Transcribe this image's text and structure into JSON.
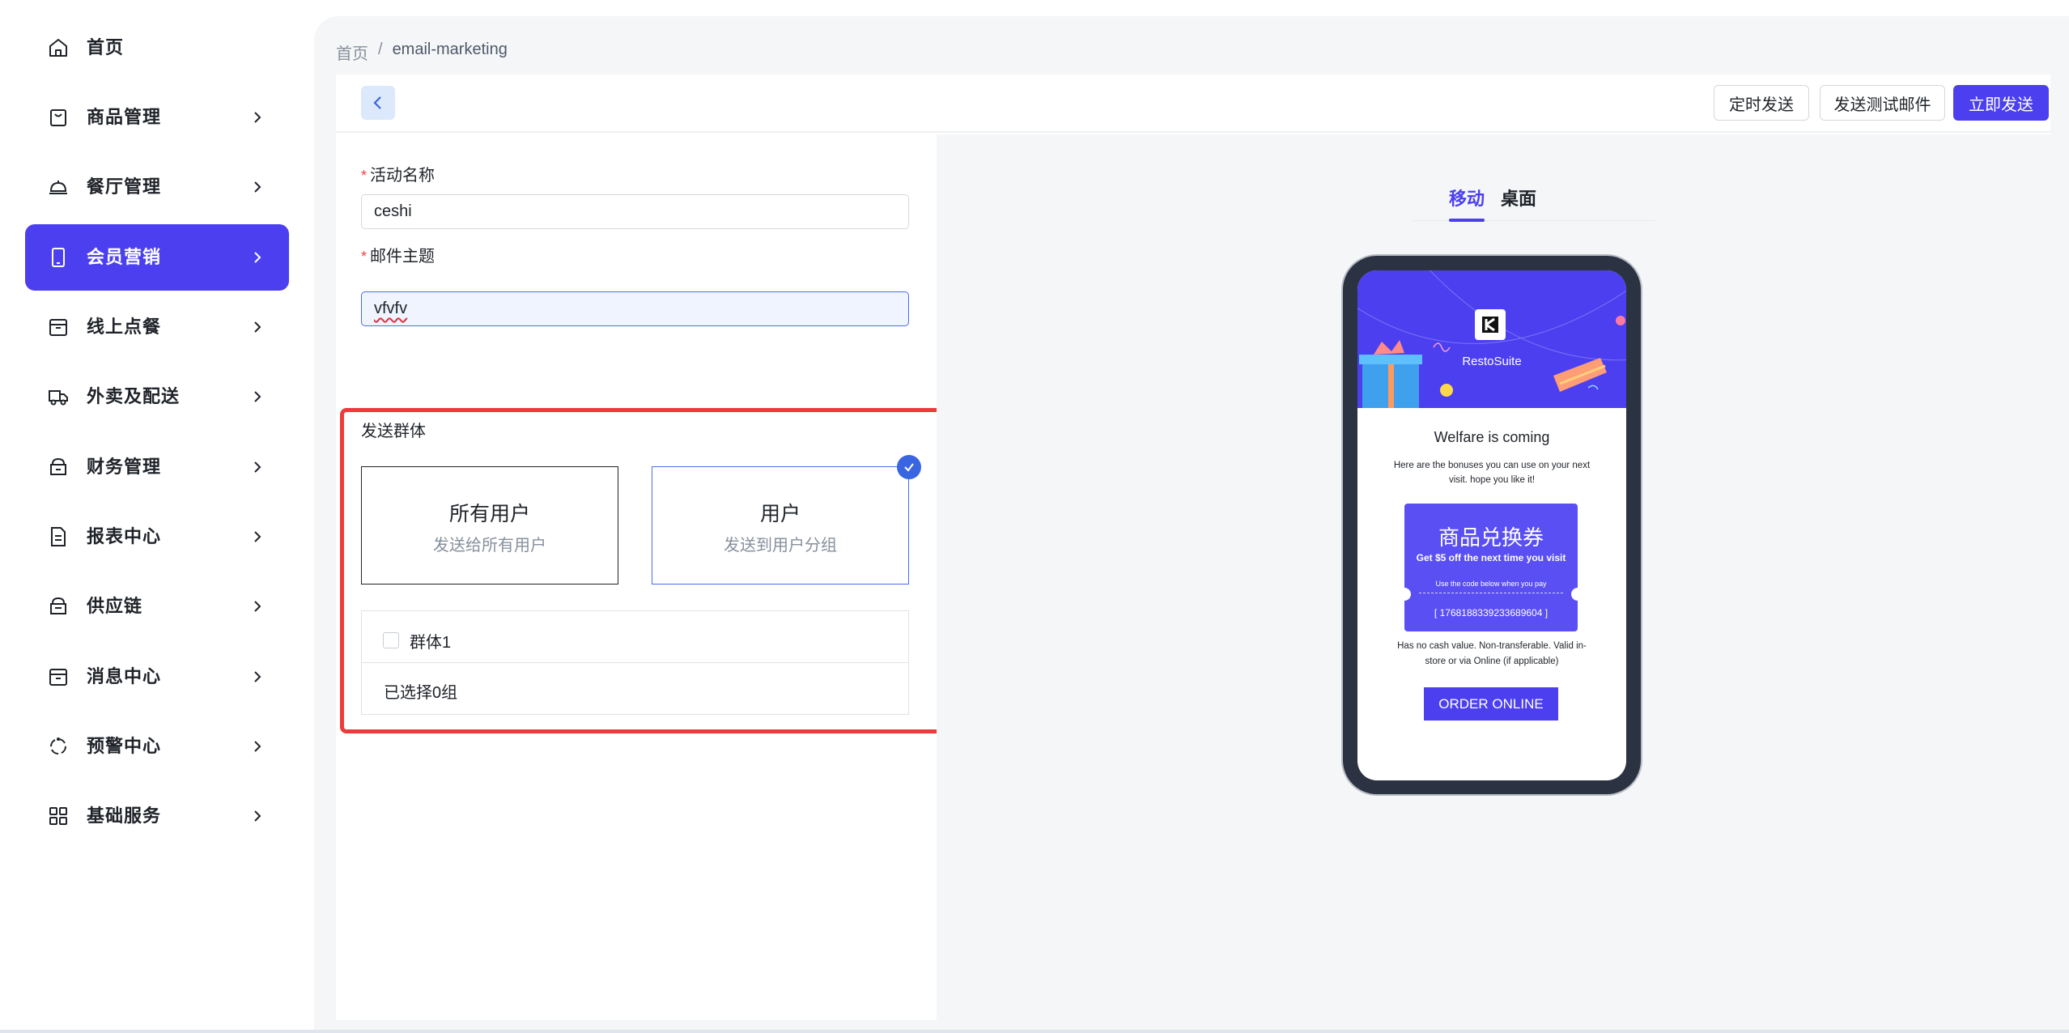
{
  "sidebar": {
    "items": [
      {
        "label": "首页",
        "icon": "home-icon",
        "active": false,
        "has_chevron": false
      },
      {
        "label": "商品管理",
        "icon": "bag-icon",
        "active": false,
        "has_chevron": true
      },
      {
        "label": "餐厅管理",
        "icon": "dome-icon",
        "active": false,
        "has_chevron": true
      },
      {
        "label": "会员营销",
        "icon": "phone-icon",
        "active": true,
        "has_chevron": true
      },
      {
        "label": "线上点餐",
        "icon": "box-icon",
        "active": false,
        "has_chevron": true
      },
      {
        "label": "外卖及配送",
        "icon": "truck-icon",
        "active": false,
        "has_chevron": true
      },
      {
        "label": "财务管理",
        "icon": "wallet-icon",
        "active": false,
        "has_chevron": true
      },
      {
        "label": "报表中心",
        "icon": "report-icon",
        "active": false,
        "has_chevron": true
      },
      {
        "label": "供应链",
        "icon": "chain-icon",
        "active": false,
        "has_chevron": true
      },
      {
        "label": "消息中心",
        "icon": "message-icon",
        "active": false,
        "has_chevron": true
      },
      {
        "label": "预警中心",
        "icon": "alert-icon",
        "active": false,
        "has_chevron": true
      },
      {
        "label": "基础服务",
        "icon": "grid-icon",
        "active": false,
        "has_chevron": true
      }
    ]
  },
  "breadcrumb": {
    "home": "首页",
    "separator": "/",
    "current": "email-marketing"
  },
  "toolbar": {
    "schedule_label": "定时发送",
    "test_label": "发送测试邮件",
    "send_label": "立即发送"
  },
  "form": {
    "activity_name": {
      "label": "活动名称",
      "required_mark": "*",
      "value": "ceshi"
    },
    "email_subject": {
      "label": "邮件主题",
      "required_mark": "*",
      "value": "vfvfv"
    },
    "audience": {
      "label": "发送群体",
      "options": [
        {
          "title": "所有用户",
          "subtitle": "发送给所有用户",
          "selected": false
        },
        {
          "title": "用户",
          "subtitle": "发送到用户分组",
          "selected": true
        }
      ],
      "groups": [
        {
          "label": "群体1",
          "checked": false
        }
      ],
      "selected_count_text": "已选择0组"
    }
  },
  "preview": {
    "tabs": [
      {
        "label": "移动",
        "active": true
      },
      {
        "label": "桌面",
        "active": false
      }
    ],
    "email": {
      "brand": "RestoSuite",
      "headline": "Welfare is coming",
      "intro": "Here are the bonuses you can use on your next visit. hope you like it!",
      "coupon_title": "商品兑换券",
      "coupon_subtitle": "Get $5 off the next time you visit",
      "coupon_hint": "Use the code below when you pay",
      "coupon_code": "[ 1768188339233689604 ]",
      "terms": "Has no cash value. Non-transferable. Valid in-store or via Online (if applicable)",
      "cta": "ORDER ONLINE"
    }
  },
  "colors": {
    "accent": "#4b3ff0",
    "required": "#f53f3f",
    "highlight": "#ee3a3a",
    "check": "#3a65e0"
  }
}
